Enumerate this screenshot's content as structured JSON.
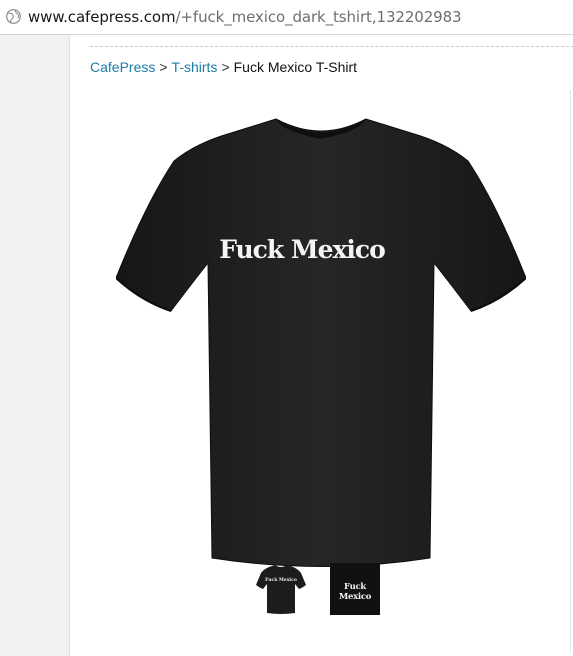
{
  "address_bar": {
    "domain": "www.cafepress.com",
    "path": "/+fuck_mexico_dark_tshirt,132202983",
    "icon": "globe-icon"
  },
  "breadcrumb": {
    "items": [
      {
        "label": "CafePress",
        "link": true
      },
      {
        "label": "T-shirts",
        "link": true
      },
      {
        "label": "Fuck Mexico T-Shirt",
        "link": false
      }
    ],
    "separator": ">"
  },
  "product": {
    "shirt_print": "Fuck Mexico",
    "shirt_color": "#1e1e1e",
    "print_color": "#f4f4f4"
  },
  "thumbnails": [
    {
      "kind": "shirt-thumb",
      "label": "Fuck Mexico"
    },
    {
      "kind": "design-thumb",
      "label": "Fuck Mexico"
    }
  ],
  "colors": {
    "link": "#1d7ca7",
    "page_bg": "#ffffff",
    "gutter_bg": "#f1f1f1"
  }
}
